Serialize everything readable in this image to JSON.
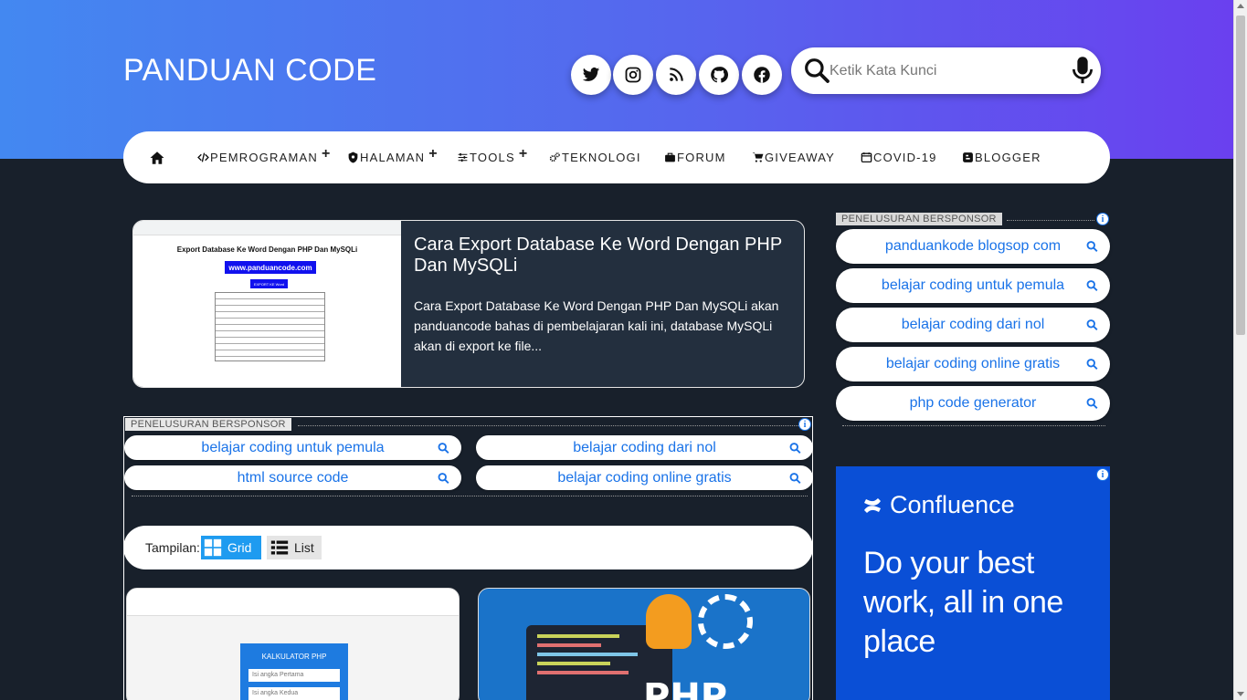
{
  "header": {
    "site_title": "PANDUAN CODE",
    "search_placeholder": "Ketik Kata Kunci",
    "social_icons": [
      "twitter-icon",
      "instagram-icon",
      "rss-icon",
      "github-icon",
      "facebook-icon"
    ]
  },
  "nav": {
    "items": [
      {
        "label": "PEMROGRAMAN",
        "icon": "code-icon",
        "has_submenu": true
      },
      {
        "label": "HALAMAN",
        "icon": "shield-icon",
        "has_submenu": true
      },
      {
        "label": "TOOLS",
        "icon": "sliders-icon",
        "has_submenu": true
      },
      {
        "label": "TEKNOLOGI",
        "icon": "gears-icon",
        "has_submenu": false
      },
      {
        "label": "FORUM",
        "icon": "briefcase-icon",
        "has_submenu": false
      },
      {
        "label": "GIVEAWAY",
        "icon": "cart-icon",
        "has_submenu": false
      },
      {
        "label": "COVID-19",
        "icon": "calendar-icon",
        "has_submenu": false
      },
      {
        "label": "BLOGGER",
        "icon": "blogger-icon",
        "has_submenu": false
      }
    ]
  },
  "featured": {
    "title": "Cara Export Database Ke Word Dengan PHP Dan MySQLi",
    "description": "Cara Export Database Ke Word Dengan PHP Dan MySQLi akan panduancode bahas di pembelajaran kali ini, database MySQLi akan di export ke file...",
    "thumb": {
      "heading": "Export Database Ke Word Dengan PHP Dan MySQLi",
      "site": "www.panduancode.com",
      "button": "EXPORT KE Word"
    }
  },
  "main_ad": {
    "label": "PENELUSURAN BERSPONSOR",
    "links": [
      "belajar coding untuk pemula",
      "belajar coding dari nol",
      "html source code",
      "belajar coding online gratis"
    ]
  },
  "view_toggle": {
    "label": "Tampilan:",
    "grid_label": "Grid",
    "list_label": "List",
    "active": "Grid"
  },
  "cards": [
    {
      "thumb_title": "KALKULATOR PHP",
      "input1": "Isi angka Pertama",
      "input2": "Isi angka Kedua"
    },
    {
      "thumb_text": "PHP"
    }
  ],
  "sidebar_ad": {
    "label": "PENELUSURAN BERSPONSOR",
    "links": [
      "panduankode blogsop com",
      "belajar coding untuk pemula",
      "belajar coding dari nol",
      "belajar coding online gratis",
      "php code generator"
    ]
  },
  "banner_ad": {
    "brand": "Confluence",
    "headline": "Do your best work, all in one place"
  },
  "colors": {
    "accent": "#1a73e8",
    "header_start": "#4388f1",
    "header_end": "#6a40ef",
    "page_bg": "#18202b"
  }
}
